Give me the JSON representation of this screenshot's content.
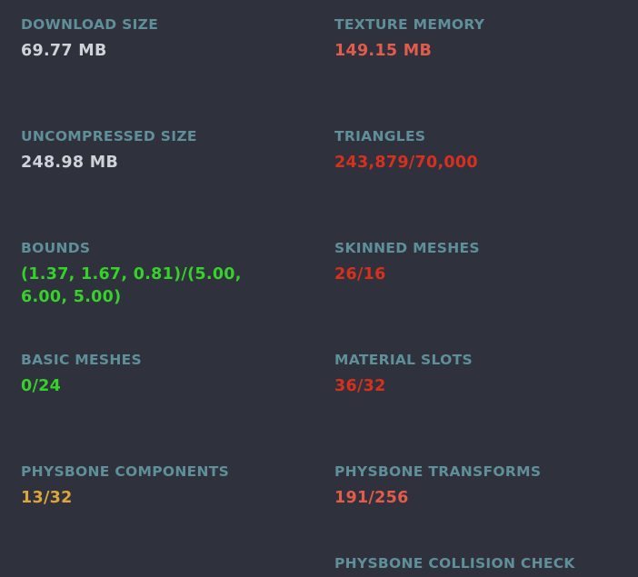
{
  "stats": {
    "download_size": {
      "label": "DOWNLOAD SIZE",
      "value": "69.77 MB",
      "color": "#cfd2d8"
    },
    "texture_memory": {
      "label": "TEXTURE MEMORY",
      "value": "149.15 MB",
      "color": "#e25b4b"
    },
    "uncompressed_size": {
      "label": "UNCOMPRESSED SIZE",
      "value": "248.98 MB",
      "color": "#cfd2d8"
    },
    "triangles": {
      "label": "TRIANGLES",
      "value": "243,879/70,000",
      "color": "#d8301f"
    },
    "bounds": {
      "label": "BOUNDS",
      "value": "(1.37, 1.67, 0.81)/(5.00, 6.00, 5.00)",
      "color": "#36d12a"
    },
    "skinned_meshes": {
      "label": "SKINNED MESHES",
      "value": "26/16",
      "color": "#d8301f"
    },
    "basic_meshes": {
      "label": "BASIC MESHES",
      "value": "0/24",
      "color": "#36d12a"
    },
    "material_slots": {
      "label": "MATERIAL SLOTS",
      "value": "36/32",
      "color": "#d8301f"
    },
    "physbone_components": {
      "label": "PHYSBONE COMPONENTS",
      "value": "13/32",
      "color": "#dba63a"
    },
    "physbone_transforms": {
      "label": "PHYSBONE TRANSFORMS",
      "value": "191/256",
      "color": "#e25b4b"
    },
    "physbone_collision_check": {
      "label": "PHYSBONE COLLISION CHECK"
    }
  }
}
